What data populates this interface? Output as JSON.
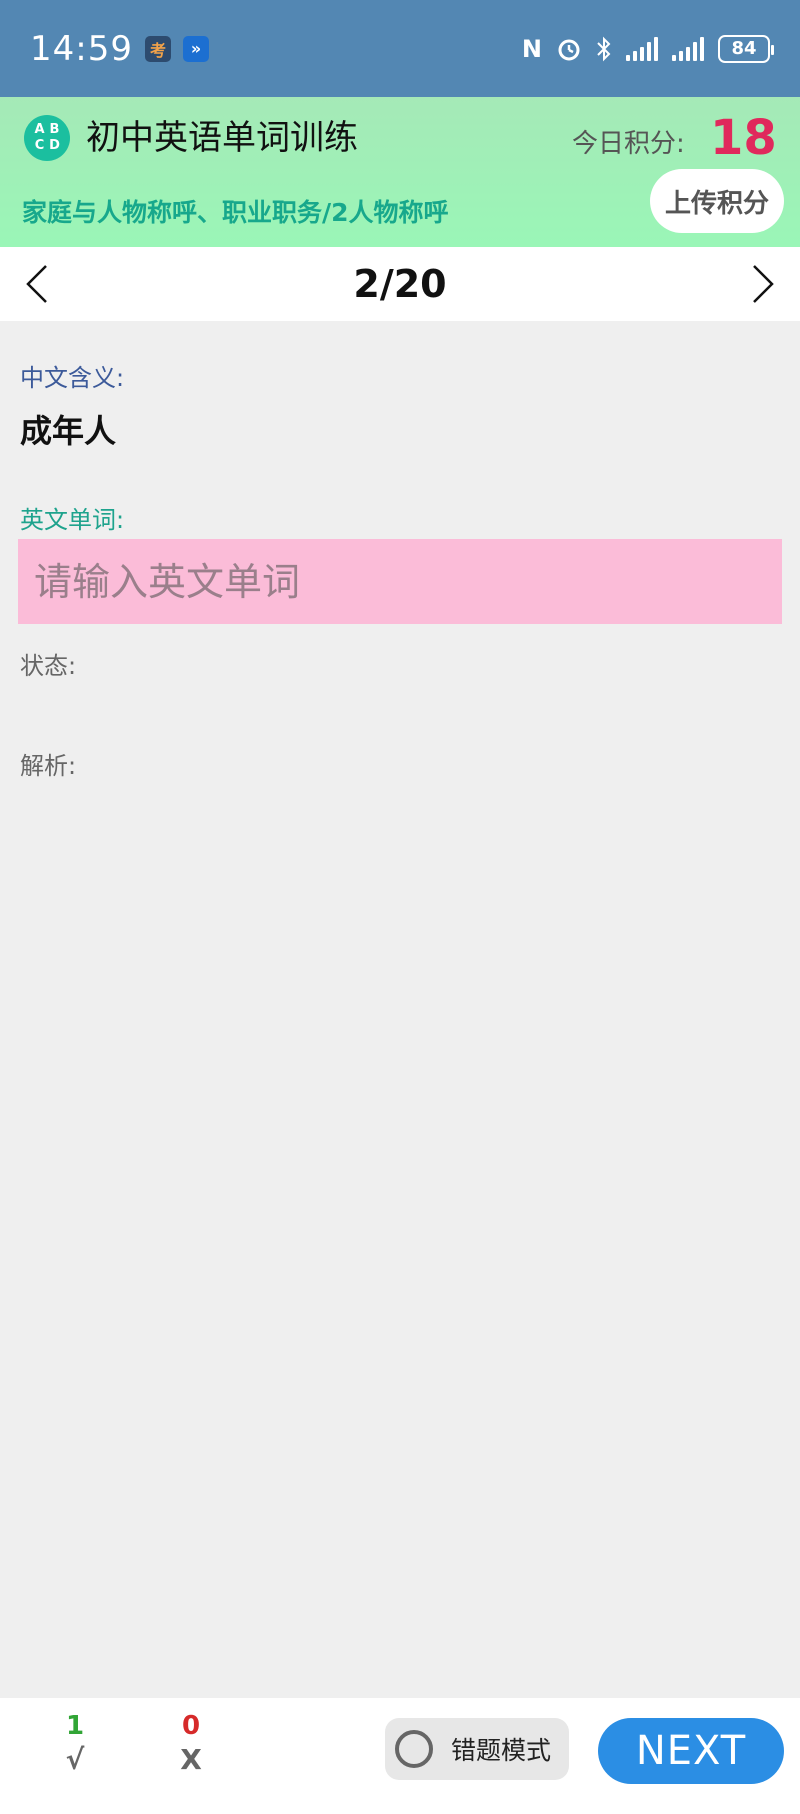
{
  "status_bar": {
    "time": "14:59",
    "battery": "84",
    "icons": [
      "app-icon-1",
      "app-icon-2",
      "nfc-icon",
      "alarm-icon",
      "bluetooth-icon",
      "signal-icon",
      "signal-icon",
      "battery-icon"
    ]
  },
  "header": {
    "logo_letters": [
      "A",
      "B",
      "C",
      "D"
    ],
    "title": "初中英语单词训练",
    "score_label": "今日积分:",
    "score_value": "18",
    "category": "家庭与人物称呼、职业职务/2人物称呼",
    "upload_label": "上传积分"
  },
  "pager": {
    "text": "2/20"
  },
  "question": {
    "cn_label": "中文含义:",
    "meaning": "成年人",
    "en_label": "英文单词:",
    "input_value": "",
    "input_placeholder": "请输入英文单词",
    "status_label": "状态:",
    "analysis_label": "解析:"
  },
  "footer": {
    "correct_count": "1",
    "correct_symbol": "√",
    "wrong_count": "0",
    "wrong_symbol": "X",
    "mode_label": "错题模式",
    "next_label": "NEXT"
  },
  "colors": {
    "status_bar": "#5387b3",
    "header_bg": "#9af6b7",
    "score": "#e0295c",
    "input_bg": "#fbbcd8",
    "next_button": "#2b8ee4",
    "correct": "#31a536",
    "wrong": "#d62a2a"
  }
}
